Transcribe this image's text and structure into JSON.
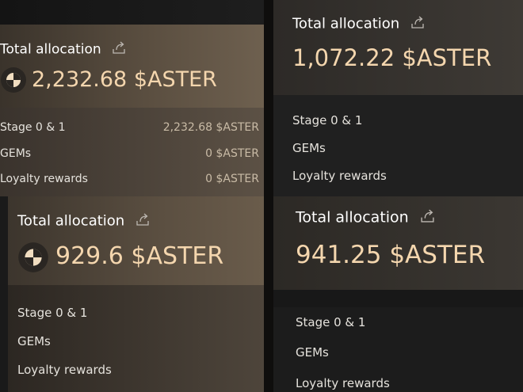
{
  "cards": [
    {
      "title": "Total allocation",
      "amount": "2,232.68 $ASTER",
      "rows": [
        {
          "label": "Stage 0 & 1",
          "value": "2,232.68 $ASTER"
        },
        {
          "label": "GEMs",
          "value": "0 $ASTER"
        },
        {
          "label": "Loyalty rewards",
          "value": "0 $ASTER"
        }
      ]
    },
    {
      "title": "Total allocation",
      "amount": "1,072.22 $ASTER",
      "rows": [
        {
          "label": "Stage 0 & 1"
        },
        {
          "label": "GEMs"
        },
        {
          "label": "Loyalty rewards"
        }
      ]
    },
    {
      "title": "Total allocation",
      "amount": "929.6 $ASTER",
      "rows": [
        {
          "label": "Stage 0 & 1"
        },
        {
          "label": "GEMs"
        },
        {
          "label": "Loyalty rewards"
        }
      ]
    },
    {
      "title": "Total allocation",
      "amount": "941.25 $ASTER",
      "rows": [
        {
          "label": "Stage 0 & 1"
        },
        {
          "label": "GEMs"
        },
        {
          "label": "Loyalty rewards"
        }
      ]
    }
  ],
  "colors": {
    "amount": "#f4d6ae",
    "label": "#e5e2dc",
    "value": "#c9bba6"
  },
  "icons": [
    "share-icon",
    "aster-coin-icon"
  ]
}
